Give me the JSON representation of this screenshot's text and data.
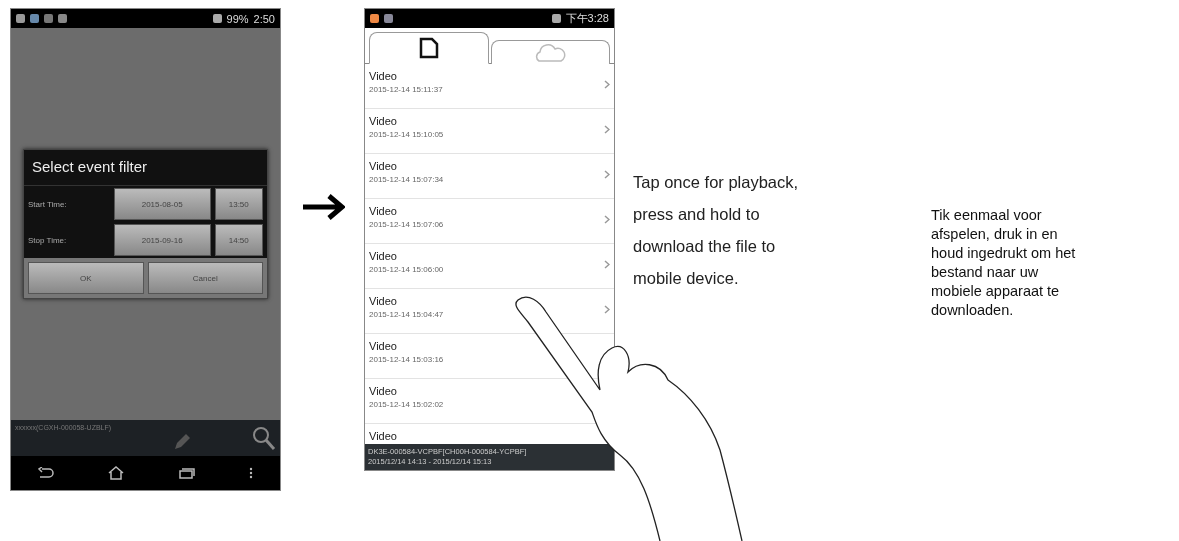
{
  "filter_phone": {
    "status_bar": {
      "battery": "99%",
      "time": "2:50"
    },
    "dialog": {
      "title": "Select event filter",
      "rows": [
        {
          "label": "Start Time:",
          "date": "2015-08-05",
          "time": "13:50"
        },
        {
          "label": "Stop Time:",
          "date": "2015-09-16",
          "time": "14:50"
        }
      ],
      "buttons": [
        "OK",
        "Cancel"
      ]
    },
    "device_label": "xxxxxx(CGXH-000058-UZBLF)"
  },
  "list_phone": {
    "status_bar": {
      "time": "下午3:28"
    },
    "tabs": [
      {
        "kind": "sd",
        "selected": true
      },
      {
        "kind": "cloud",
        "selected": false
      }
    ],
    "videos": [
      {
        "title": "Video",
        "time": "2015-12-14 15:11:37"
      },
      {
        "title": "Video",
        "time": "2015-12-14 15:10:05"
      },
      {
        "title": "Video",
        "time": "2015-12-14 15:07:34"
      },
      {
        "title": "Video",
        "time": "2015-12-14 15:07:06"
      },
      {
        "title": "Video",
        "time": "2015-12-14 15:06:00"
      },
      {
        "title": "Video",
        "time": "2015-12-14 15:04:47"
      },
      {
        "title": "Video",
        "time": "2015-12-14 15:03:16"
      },
      {
        "title": "Video",
        "time": "2015-12-14 15:02:02"
      },
      {
        "title": "Video"
      }
    ],
    "footer": [
      "DK3E-000584-VCPBF[CH00H-000584-YCPBF]",
      "2015/12/14 14:13 - 2015/12/14 15:13"
    ]
  },
  "caption_en": [
    "Tap once for playback,",
    "press and hold to",
    "download the file to",
    "mobile device."
  ],
  "caption_nl": [
    "Tik eenmaal voor",
    "afspelen, druk in en",
    "houd ingedrukt om het",
    "bestand naar uw",
    "mobiele apparaat te",
    "downloaden."
  ]
}
